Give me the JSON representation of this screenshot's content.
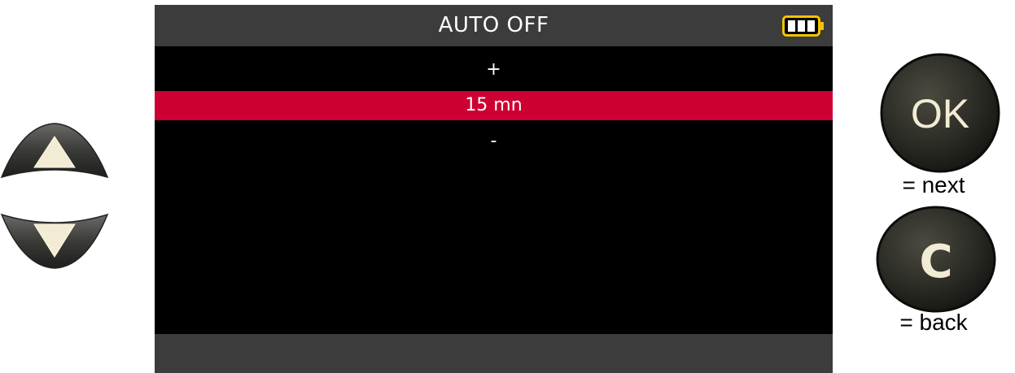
{
  "screen": {
    "title": "AUTO OFF",
    "battery_icon": "battery-full-icon",
    "increment_label": "+",
    "selected_value": "15 mn",
    "decrement_label": "-",
    "highlight_color": "#cc0033",
    "bar_color": "#3c3c3c"
  },
  "keys": {
    "up_icon": "arrow-up-icon",
    "down_icon": "arrow-down-icon",
    "ok_label": "OK",
    "ok_caption": "= next",
    "c_label": "C",
    "c_caption": "= back"
  }
}
